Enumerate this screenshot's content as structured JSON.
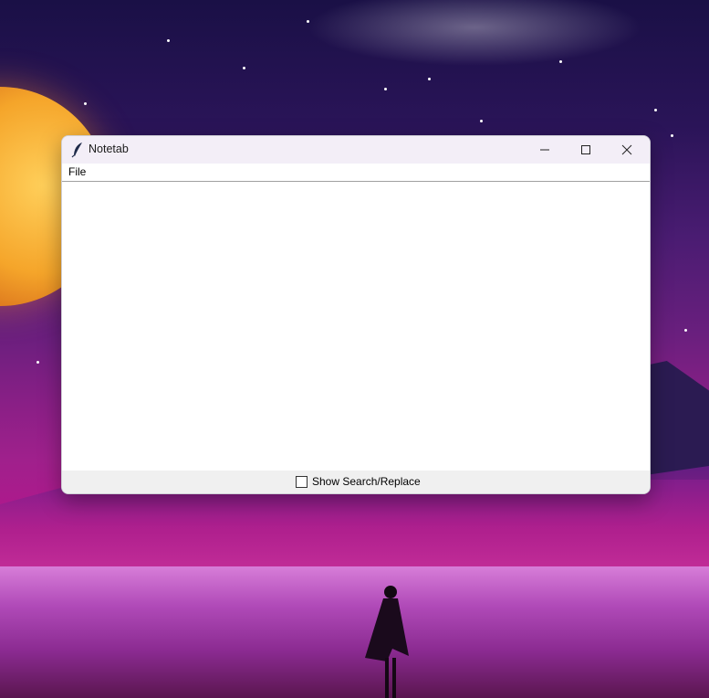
{
  "window": {
    "title": "Notetab",
    "minimize_icon": "minimize-icon",
    "maximize_icon": "maximize-icon",
    "close_icon": "close-icon",
    "app_icon": "feather-quill-icon"
  },
  "menubar": {
    "items": [
      {
        "label": "File"
      }
    ]
  },
  "editor": {
    "value": ""
  },
  "footer": {
    "checkbox_label": "Show Search/Replace",
    "checkbox_checked": false
  },
  "colors": {
    "titlebar_bg": "#f3eef7",
    "statusbar_bg": "#f0f0f0",
    "window_bg": "#ffffff"
  }
}
